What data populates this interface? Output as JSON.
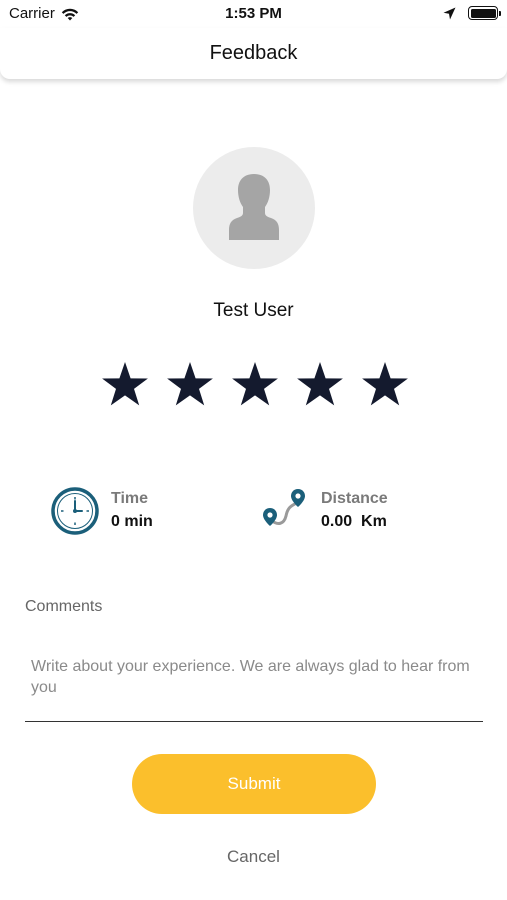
{
  "status_bar": {
    "carrier": "Carrier",
    "time": "1:53 PM",
    "icons": [
      "wifi-icon",
      "location-arrow-icon",
      "battery-icon"
    ]
  },
  "header": {
    "title": "Feedback"
  },
  "user": {
    "name": "Test User",
    "avatar_icon": "person-silhouette-icon"
  },
  "rating": {
    "value": 5,
    "max": 5,
    "star_color": "#141a2e"
  },
  "stats": {
    "time": {
      "label": "Time",
      "value": "0 min",
      "icon": "clock-icon"
    },
    "distance": {
      "label": "Distance",
      "value": "0.00  Km",
      "icon": "route-icon"
    }
  },
  "comments": {
    "label": "Comments",
    "value": "",
    "placeholder": "Write about your experience. We are always glad to hear from you"
  },
  "actions": {
    "submit_label": "Submit",
    "cancel_label": "Cancel"
  },
  "colors": {
    "accent": "#fbbf2c",
    "icon_teal": "#1b5f7a",
    "avatar_bg": "#ececec"
  }
}
